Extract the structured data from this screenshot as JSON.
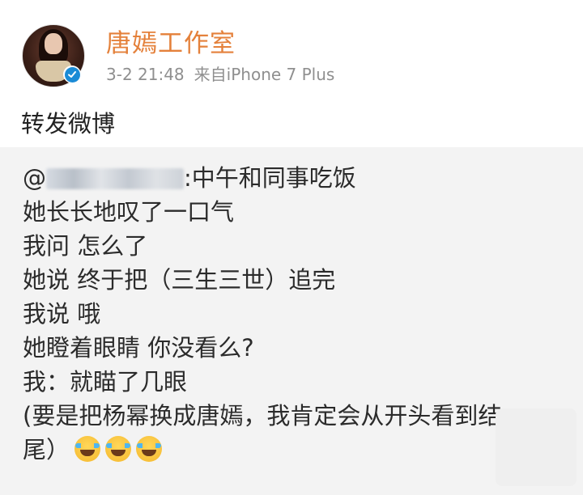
{
  "post": {
    "author_name": "唐嫣工作室",
    "timestamp": "3-2 21:48",
    "source": "来自iPhone 7 Plus",
    "repost_text": "转发微博"
  },
  "quoted": {
    "mention_prefix": "@",
    "lines": [
      ":中午和同事吃饭",
      "她长长地叹了一口气",
      "我问 怎么了",
      "她说 终于把（三生三世）追完",
      "我说 哦",
      "她瞪着眼睛 你没看么?",
      "我：就瞄了几眼",
      "(要是把杨幂换成唐嫣，我肯定会从开头看到结",
      "尾）"
    ],
    "emoji_icons": [
      "laugh-cry-icon",
      "laugh-cry-icon",
      "laugh-cry-icon"
    ]
  },
  "colors": {
    "author": "#e4813b",
    "meta": "#8f8f8f",
    "quote_background": "#f3f3f3",
    "verified_badge": "#1a8bd6"
  }
}
